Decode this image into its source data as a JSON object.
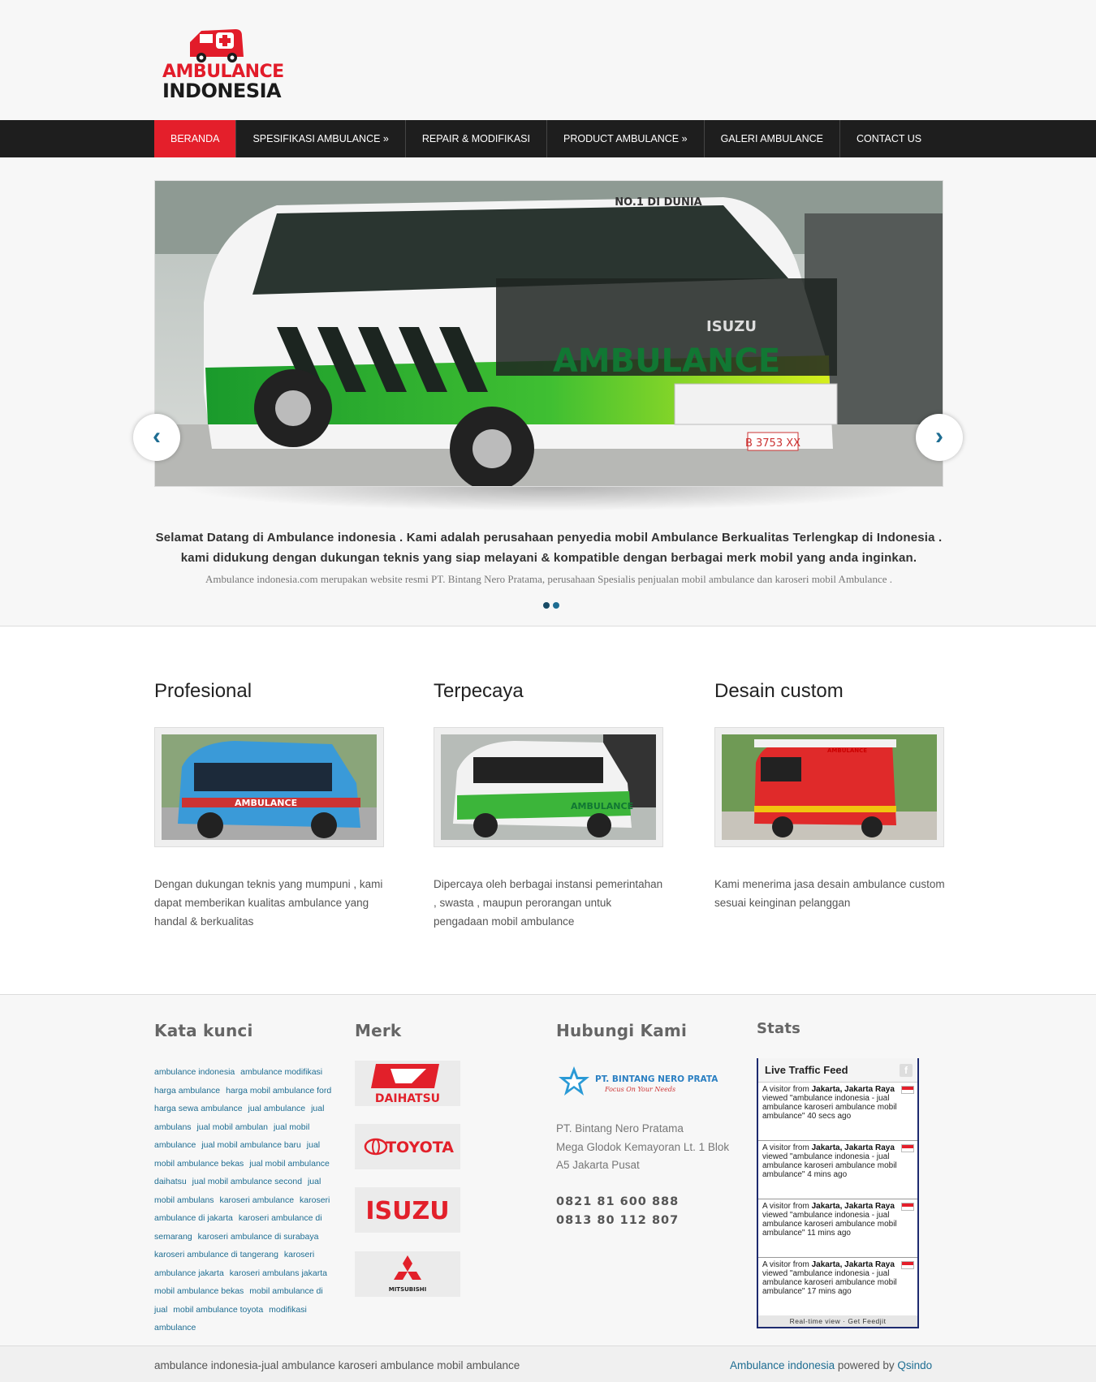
{
  "logo": {
    "line1": "AMBULANCE",
    "line2": "INDONESIA"
  },
  "nav": {
    "items": [
      {
        "label": "BERANDA",
        "active": true
      },
      {
        "label": "SPESIFIKASI AMBULANCE »"
      },
      {
        "label": "REPAIR & MODIFIKASI"
      },
      {
        "label": "PRODUCT AMBULANCE »"
      },
      {
        "label": "GALERI AMBULANCE"
      },
      {
        "label": "CONTACT US"
      }
    ]
  },
  "slider": {
    "headline": "Selamat Datang di Ambulance indonesia . Kami adalah perusahaan penyedia mobil Ambulance Berkualitas Terlengkap di Indonesia . kami didukung dengan dukungan teknis yang siap melayani & kompatible dengan berbagai merk mobil yang anda inginkan.",
    "subline": "Ambulance indonesia.com merupakan website resmi PT. Bintang Nero Pratama, perusahaan Spesialis penjualan mobil ambulance dan karoseri mobil Ambulance .",
    "prev_icon": "chevron-left-icon",
    "next_icon": "chevron-right-icon",
    "van_texts": {
      "top": "NO.1 DI DUNIA",
      "brand": "ISUZU",
      "side": "AMBULANCE",
      "plate": "B 3753 XX"
    }
  },
  "features": [
    {
      "title": "Profesional",
      "text": "Dengan dukungan teknis yang mumpuni , kami dapat memberikan kualitas ambulance yang handal & berkualitas",
      "photo_text": "AMBULANCE"
    },
    {
      "title": "Terpecaya",
      "text": "Dipercaya oleh berbagai instansi pemerintahan , swasta , maupun perorangan untuk pengadaan mobil ambulance",
      "photo_text": "AMBULANCE"
    },
    {
      "title": "Desain custom",
      "text": "Kami menerima jasa desain ambulance custom sesuai keinginan pelanggan",
      "photo_text": "AMBULANCE"
    }
  ],
  "footer": {
    "tags_title": "Kata kunci",
    "tags": [
      "ambulance indonesia",
      "ambulance modifikasi",
      "harga ambulance",
      "harga mobil ambulance ford",
      "harga sewa ambulance",
      "jual ambulance",
      "jual ambulans",
      "jual mobil ambulan",
      "jual mobil ambulance",
      "jual mobil ambulance baru",
      "jual mobil ambulance bekas",
      "jual mobil ambulance daihatsu",
      "jual mobil ambulance second",
      "jual mobil ambulans",
      "karoseri ambulance",
      "karoseri ambulance di jakarta",
      "karoseri ambulance di semarang",
      "karoseri ambulance di surabaya",
      "karoseri ambulance di tangerang",
      "karoseri ambulance jakarta",
      "karoseri ambulans jakarta",
      "mobil ambulance bekas",
      "mobil ambulance di jual",
      "mobil ambulance toyota",
      "modifikasi ambulance"
    ],
    "brands_title": "Merk",
    "brands": [
      "DAIHATSU",
      "TOYOTA",
      "ISUZU",
      "MITSUBISHI"
    ],
    "contact_title": "Hubungi Kami",
    "contact_logo_text": "PT. BINTANG NERO PRATAMA",
    "contact_logo_tagline": "Focus On Your Needs",
    "address_lines": [
      "PT. Bintang Nero Pratama",
      "Mega Glodok Kemayoran Lt. 1 Blok",
      "A5 Jakarta Pusat"
    ],
    "phones": [
      "0821 81 600 888",
      "0813 80 112 807"
    ],
    "stats_title": "Stats",
    "feed": {
      "title": "Live Traffic Feed",
      "badge": "f",
      "items": [
        {
          "prefix": "A visitor from",
          "location": "Jakarta, Jakarta Raya",
          "action": "viewed \"ambulance indonesia - jual ambulance karoseri ambulance mobil ambulance\" 40 secs ago"
        },
        {
          "prefix": "A visitor from",
          "location": "Jakarta, Jakarta Raya",
          "action": "viewed \"ambulance indonesia - jual ambulance karoseri ambulance mobil ambulance\" 4 mins ago"
        },
        {
          "prefix": "A visitor from",
          "location": "Jakarta, Jakarta Raya",
          "action": "viewed \"ambulance indonesia - jual ambulance karoseri ambulance mobil ambulance\" 11 mins ago"
        },
        {
          "prefix": "A visitor from",
          "location": "Jakarta, Jakarta Raya",
          "action": "viewed \"ambulance indonesia - jual ambulance karoseri ambulance mobil ambulance\" 17 mins ago"
        }
      ],
      "footer": "Real-time view · Get Feedjit"
    }
  },
  "bottom": {
    "left": "ambulance indonesia-jual ambulance karoseri ambulance mobil ambulance",
    "site_link": "Ambulance indonesia",
    "powered": " powered by ",
    "author_link": "Qsindo"
  },
  "colors": {
    "nav_bg": "#1e1e1e",
    "active": "#e41f2b",
    "link": "#1e6d92"
  }
}
